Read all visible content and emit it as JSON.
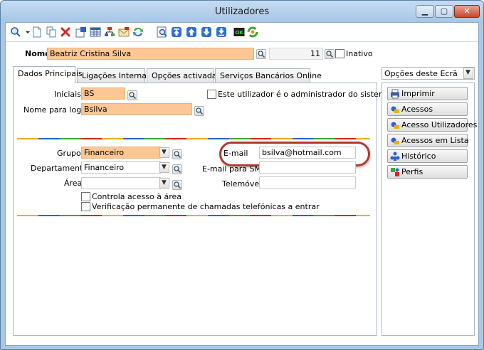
{
  "window": {
    "title": "Utilizadores"
  },
  "toolbar": {
    "icons": [
      "search-icon",
      "new-document-icon",
      "copy-icon",
      "delete-icon",
      "properties-icon",
      "grid-icon",
      "hierarchy-icon",
      "email-icon",
      "refresh-icon",
      "preview-icon",
      "first-record-icon",
      "previous-record-icon",
      "next-record-icon",
      "last-record-icon",
      "ok-icon",
      "sync-icon"
    ]
  },
  "header": {
    "name_label": "Nome",
    "name_value": "Beatriz Cristina Silva",
    "number_value": "11",
    "inactive_label": "Inativo"
  },
  "tabs": [
    {
      "label": "Dados Principais",
      "active": true
    },
    {
      "label": "Ligações Internas",
      "active": false
    },
    {
      "label": "Opções activadas",
      "active": false
    },
    {
      "label": "Serviços Bancários Online",
      "active": false
    }
  ],
  "main": {
    "initials_label": "Iniciais",
    "initials_value": "BS",
    "admin_label": "Este utilizador é o administrador do sistema",
    "login_label": "Nome para login",
    "login_value": "Bsilva",
    "group_label": "Grupo",
    "group_value": "Financeiro",
    "department_label": "Departamento",
    "department_value": "Financeiro",
    "area_label": "Área",
    "area_value": "",
    "email_label": "E-mail",
    "email_value": "bsilva@hotmail.com",
    "sms_label": "E-mail para SMS",
    "sms_value": "",
    "mobile_label": "Telemóvel",
    "mobile_value": "",
    "access_control_label": "Controla acesso à área",
    "call_check_label": "Verificação permanente de chamadas telefónicas a entrar"
  },
  "side": {
    "options_label": "Opções deste Ecrã",
    "buttons": [
      {
        "label": "Imprimir",
        "icon": "printer-icon"
      },
      {
        "label": "Acessos",
        "icon": "key-icon"
      },
      {
        "label": "Acesso Utilizadores",
        "icon": "users-key-icon"
      },
      {
        "label": "Acessos em Lista",
        "icon": "list-key-icon"
      },
      {
        "label": "Histórico",
        "icon": "history-icon"
      },
      {
        "label": "Perfis",
        "icon": "profiles-icon"
      }
    ]
  },
  "colors": {
    "highlight_field": "#fcc795",
    "email_ring": "#b23a2e",
    "title_bar": "#a9c8e6"
  }
}
